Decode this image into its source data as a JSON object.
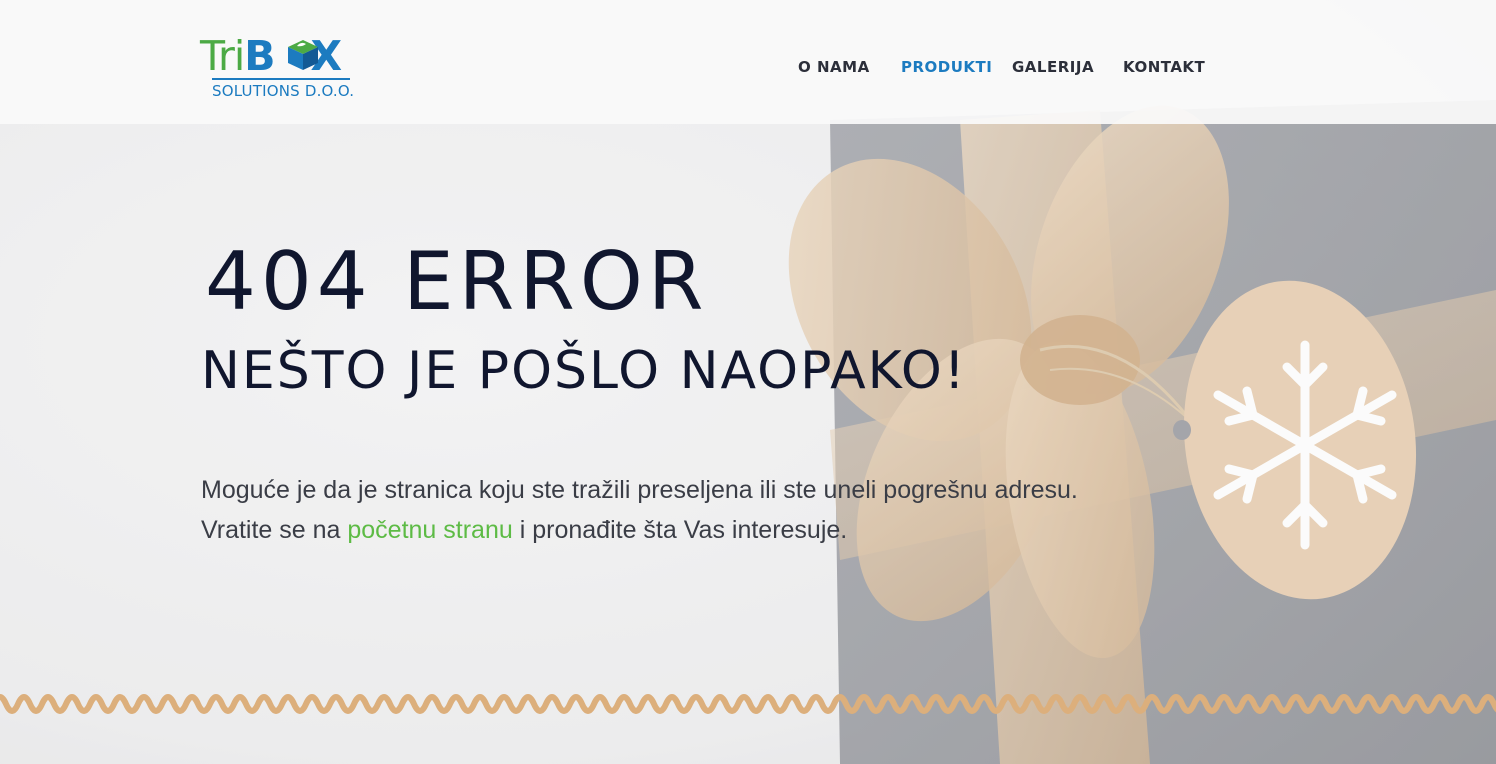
{
  "logo": {
    "brand_part1": "Tri",
    "brand_part2": "B",
    "brand_part3": "X",
    "tagline": "SOLUTIONS D.O.O.",
    "cube_icon": "cube-icon"
  },
  "nav": {
    "items": [
      {
        "label": "O NAMA",
        "active": false
      },
      {
        "label": "PRODUKTI",
        "active": true
      },
      {
        "label": "GALERIJA",
        "active": false
      },
      {
        "label": "KONTAKT",
        "active": false
      }
    ]
  },
  "hero": {
    "error_title": "404 ERROR",
    "subtitle": "NEŠTO JE POŠLO NAOPAKO!",
    "line1": "Moguće je da je stranica koju ste tražili preseljena ili ste uneli pogrešnu adresu.",
    "line2_before": "Vratite se na ",
    "line2_link": "početnu stranu",
    "line2_after": " i pronađite šta Vas interesuje."
  },
  "colors": {
    "brand_green": "#4caa45",
    "brand_blue": "#1c7bc0",
    "heading": "#10162e",
    "link": "#5dbb45",
    "wave": "#dcaf7c"
  },
  "background": {
    "image": "gift-box-with-ribbon-and-snowflake-tag"
  }
}
